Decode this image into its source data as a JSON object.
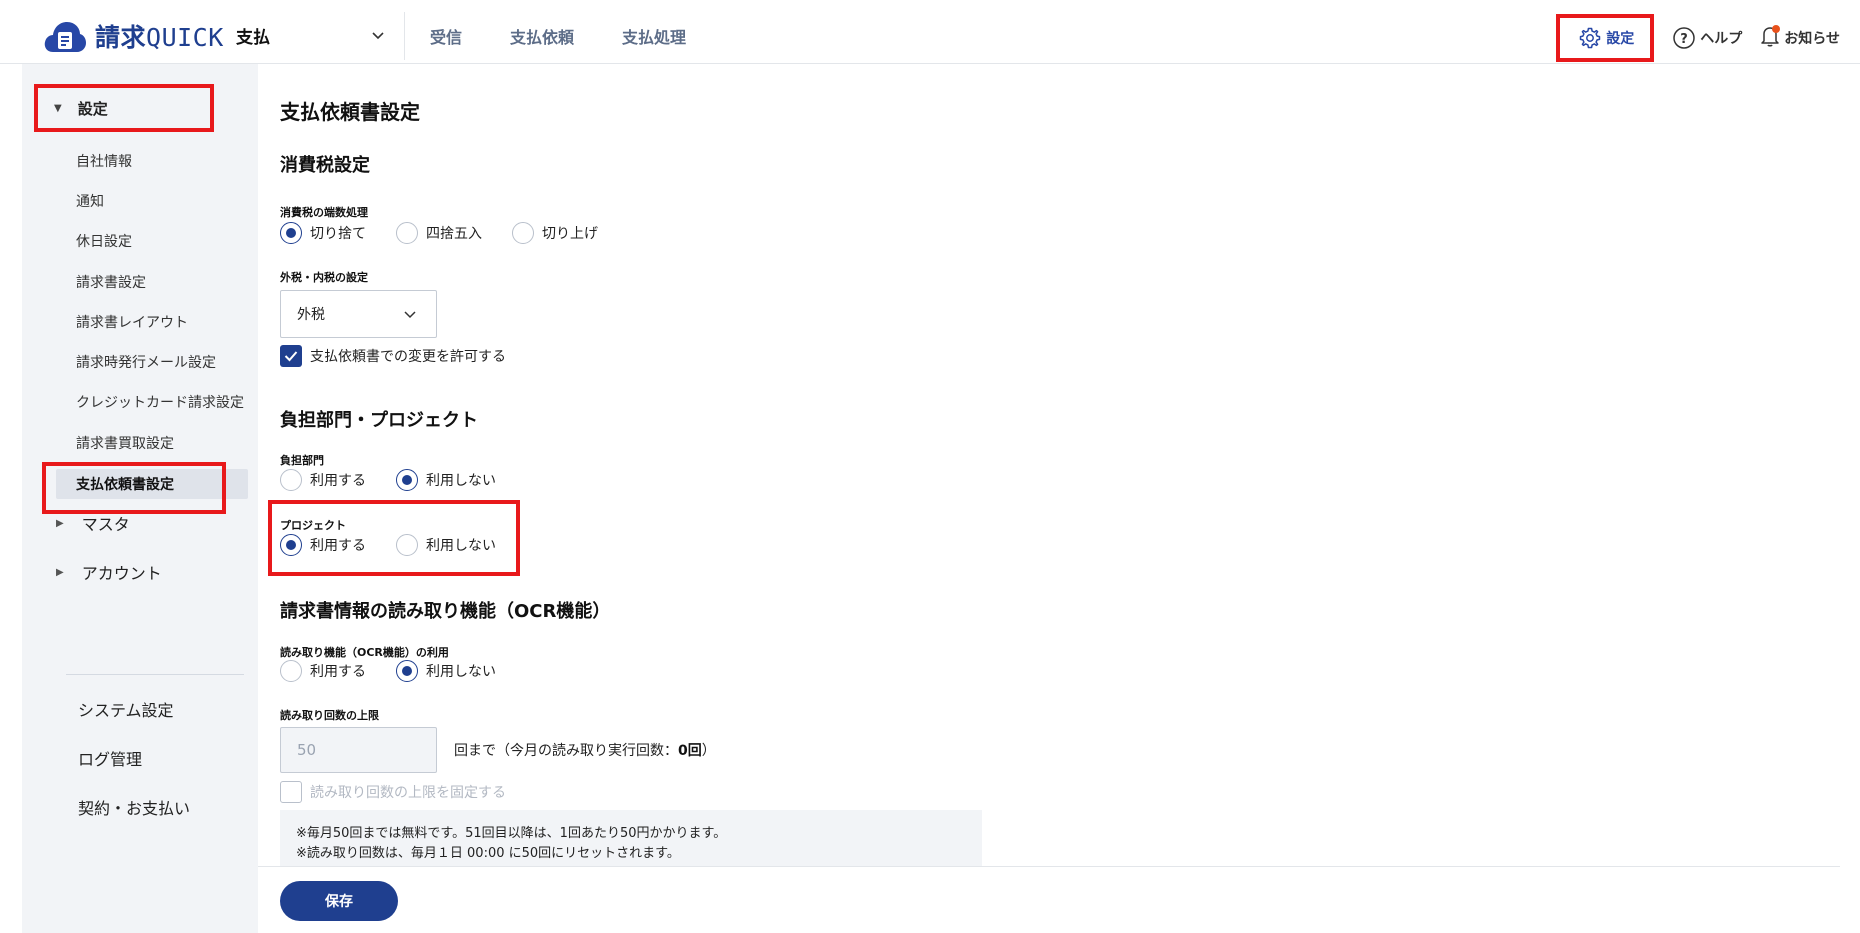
{
  "header": {
    "logo_text_kanji": "請求",
    "logo_text_latin": "QUICK",
    "product": "支払",
    "nav_tabs": [
      "受信",
      "支払依頼",
      "支払処理"
    ],
    "settings_label": "設定",
    "help_label": "ヘルプ",
    "notice_label": "お知らせ"
  },
  "sidebar": {
    "group_label": "設定",
    "items": [
      "自社情報",
      "通知",
      "休日設定",
      "請求書設定",
      "請求書レイアウト",
      "請求時発行メール設定",
      "クレジットカード請求設定",
      "請求書買取設定",
      "支払依頼書設定"
    ],
    "active_item": "支払依頼書設定",
    "collapsed": [
      "マスタ",
      "アカウント"
    ],
    "links": [
      "システム設定",
      "ログ管理",
      "契約・お支払い"
    ]
  },
  "main": {
    "page_title": "支払依頼書設定",
    "tax": {
      "section_title": "消費税設定",
      "rounding_label": "消費税の端数処理",
      "rounding_options": [
        "切り捨て",
        "四捨五入",
        "切り上げ"
      ],
      "rounding_selected": "切り捨て",
      "inclusion_label": "外税・内税の設定",
      "inclusion_value": "外税",
      "allow_change_label": "支払依頼書での変更を許可する",
      "allow_change_checked": true
    },
    "dept": {
      "section_title": "負担部門・プロジェクト",
      "dept_label": "負担部門",
      "dept_options": [
        "利用する",
        "利用しない"
      ],
      "dept_selected": "利用しない",
      "project_label": "プロジェクト",
      "project_options": [
        "利用する",
        "利用しない"
      ],
      "project_selected": "利用する"
    },
    "ocr": {
      "section_title": "請求書情報の読み取り機能（OCR機能）",
      "use_label": "読み取り機能（OCR機能）の利用",
      "use_options": [
        "利用する",
        "利用しない"
      ],
      "use_selected": "利用しない",
      "limit_label": "読み取り回数の上限",
      "limit_value": "50",
      "limit_suffix_prefix": "回まで（今月の読み取り実行回数：",
      "limit_count": "0回",
      "limit_suffix_end": "）",
      "fix_limit_label": "読み取り回数の上限を固定する",
      "fix_limit_checked": false,
      "note_line1": "※毎月50回までは無料です。51回目以降は、1回あたり50円かかります。",
      "note_line2": "※読み取り回数は、毎月１日 00:00 に50回にリセットされます。"
    },
    "save_label": "保存"
  },
  "colors": {
    "brand": "#1f3f8f",
    "highlight": "#e8191b",
    "sidebar_bg": "#f2f4f7"
  }
}
